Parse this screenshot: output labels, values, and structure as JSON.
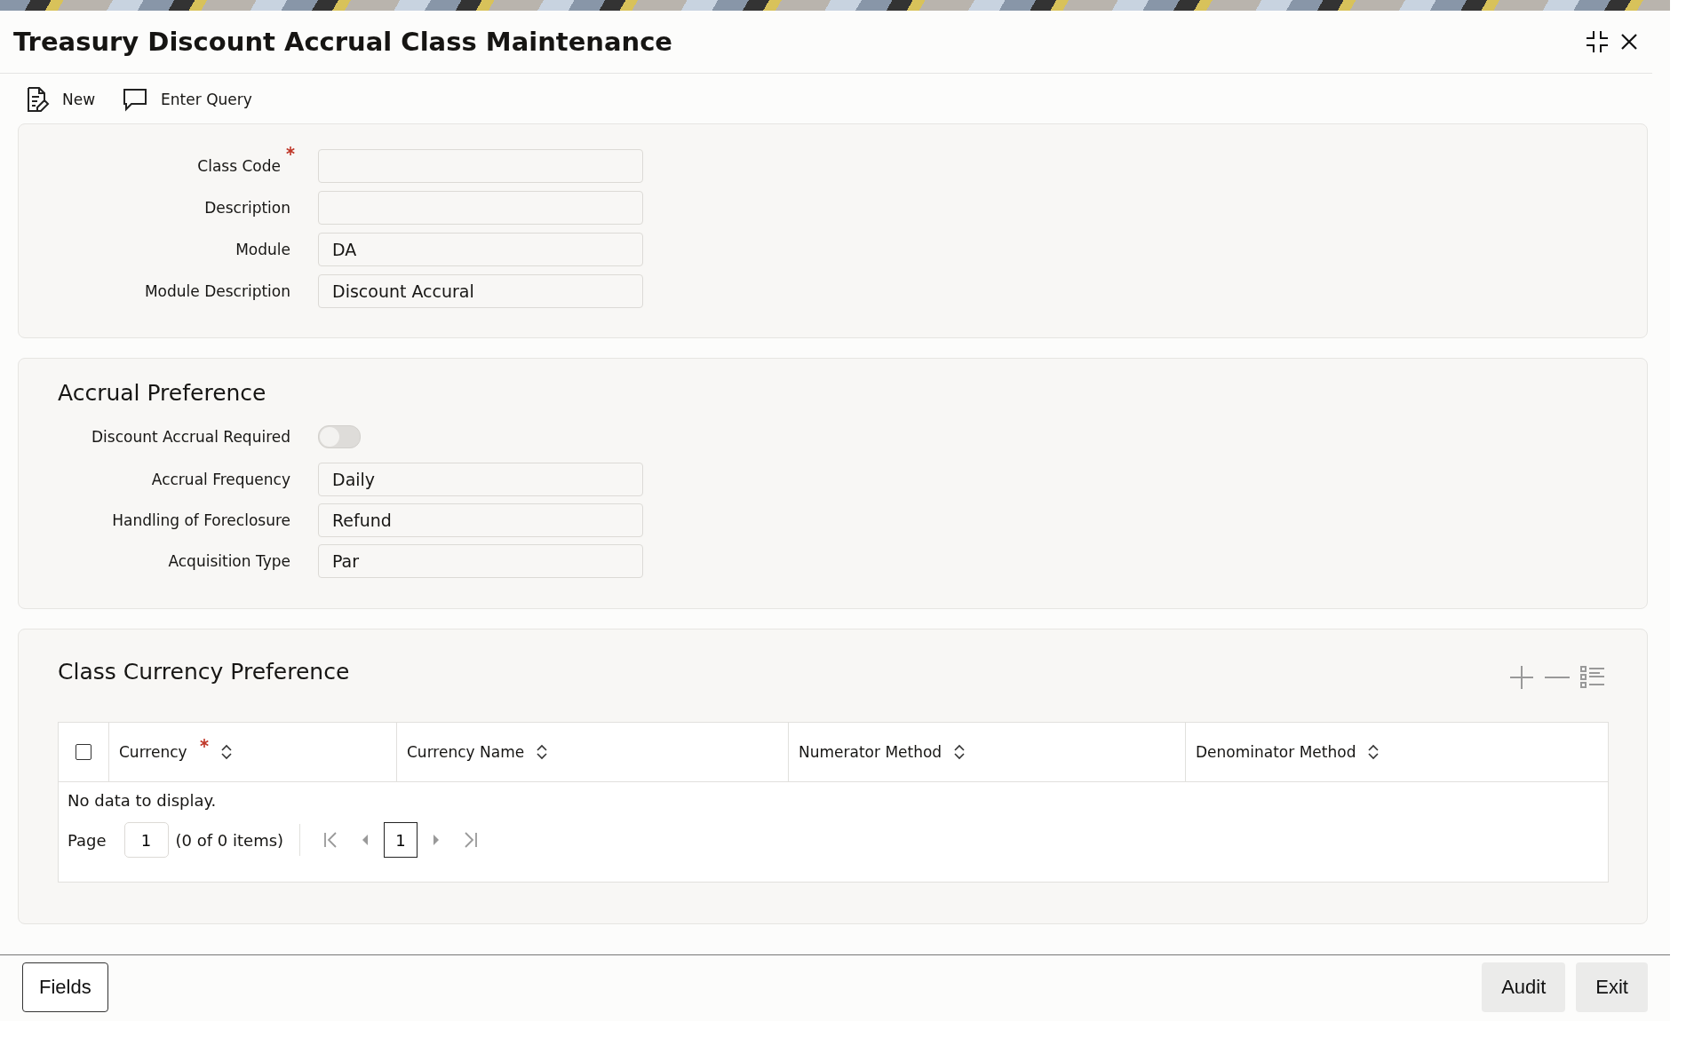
{
  "window": {
    "title": "Treasury Discount Accrual Class Maintenance"
  },
  "toolbar": [
    {
      "kind": "new",
      "label": "New"
    },
    {
      "kind": "query",
      "label": "Enter Query"
    }
  ],
  "main_fields": [
    {
      "label": "Class Code",
      "required": true
    },
    {
      "label": "Description",
      "required": false
    },
    {
      "label": "Module",
      "value": "DA",
      "required": false
    },
    {
      "label": "Module Description",
      "value": "Discount Accural",
      "required": false
    }
  ],
  "accrual_preference": {
    "title": "Accrual Preference",
    "fields": [
      {
        "kind": "toggle",
        "label": "Discount Accrual Required",
        "on": false
      },
      {
        "kind": "text",
        "label": "Accrual Frequency",
        "value": "Daily"
      },
      {
        "kind": "text",
        "label": "Handling of Foreclosure",
        "value": "Refund"
      },
      {
        "kind": "text",
        "label": "Acquisition Type",
        "value": "Par"
      }
    ]
  },
  "class_currency_preference": {
    "title": "Class Currency Preference",
    "select_all_checked": false,
    "columns": [
      {
        "label": "Currency",
        "required": true
      },
      {
        "label": "Currency Name",
        "required": false
      },
      {
        "label": "Numerator Method",
        "required": false
      },
      {
        "label": "Denominator Method",
        "required": false
      }
    ],
    "empty_message": "No data to display.",
    "pagination": {
      "label": "Page",
      "page": "1",
      "summary": "(0 of 0 items)",
      "current": "1"
    }
  },
  "footer": {
    "left": [
      "Fields"
    ],
    "right": [
      "Audit",
      "Exit"
    ]
  }
}
